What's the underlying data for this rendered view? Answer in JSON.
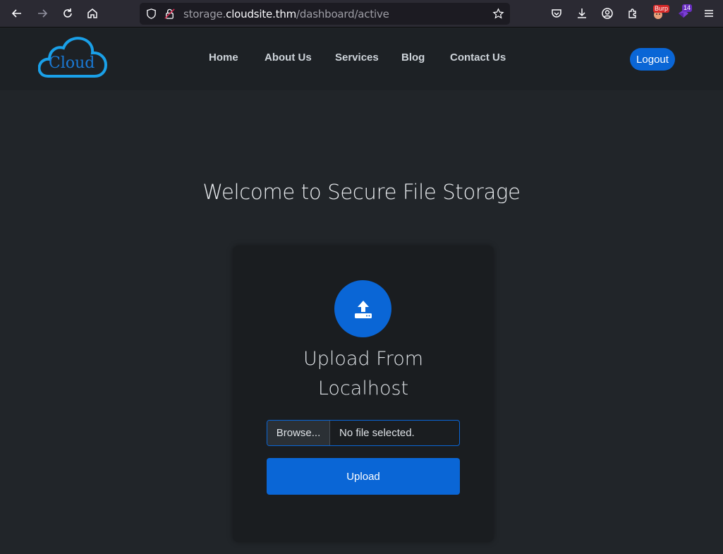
{
  "browser": {
    "url_scheme_host_prefix": "storage.",
    "url_host": "cloudsite.thm",
    "url_path": "/dashboard/active",
    "ext_badge_1": "Burp",
    "ext_badge_2": "14"
  },
  "logo": {
    "text": "Cloud"
  },
  "nav": {
    "items": [
      "Home",
      "About Us",
      "Services",
      "Blog",
      "Contact Us"
    ],
    "logout": "Logout"
  },
  "main": {
    "title": "Welcome to Secure File Storage",
    "card_heading_line1": "Upload From",
    "card_heading_line2": "Localhost",
    "browse_label": "Browse...",
    "file_status": "No file selected.",
    "upload_label": "Upload"
  },
  "colors": {
    "accent": "#0a66d6",
    "background": "#212529",
    "header": "#1d2125",
    "card": "#1a1d20"
  }
}
